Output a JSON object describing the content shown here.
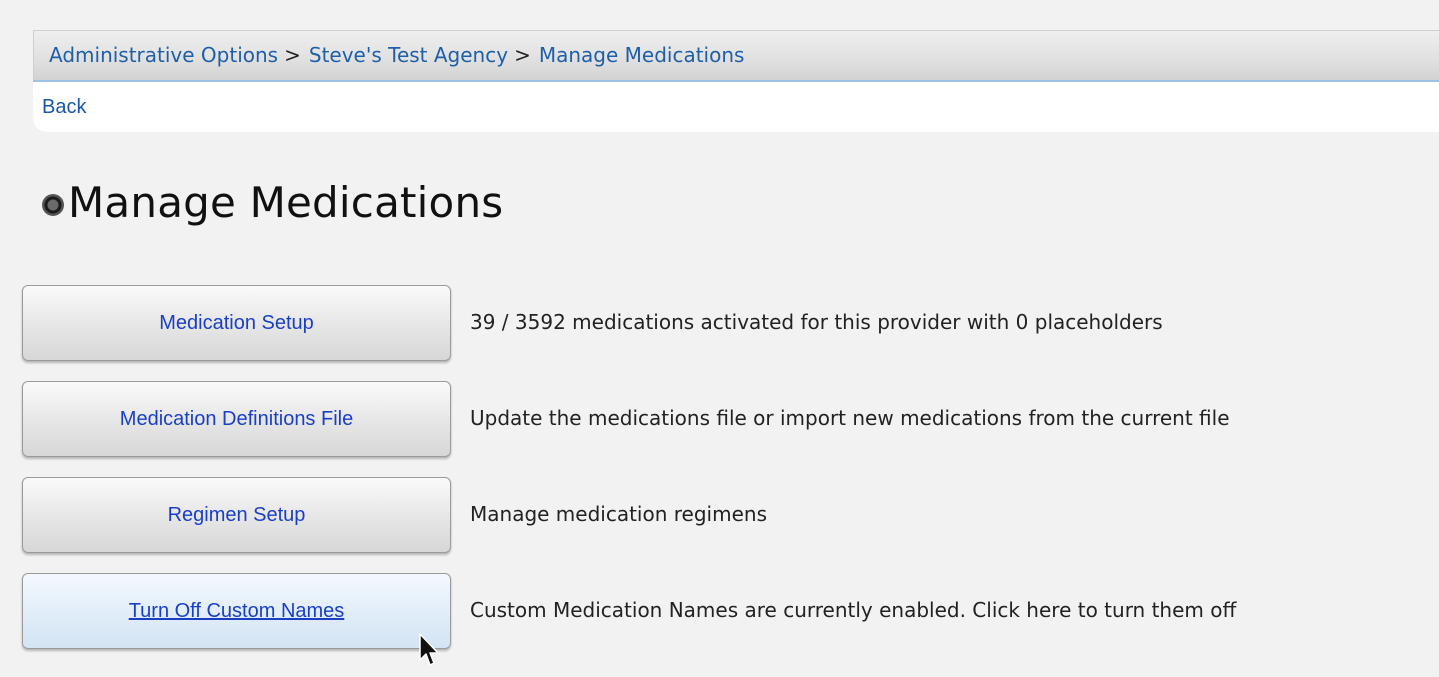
{
  "breadcrumb": {
    "items": [
      "Administrative Options",
      "Steve's Test Agency",
      "Manage Medications"
    ],
    "separator": ">"
  },
  "nav": {
    "back_label": "Back"
  },
  "page": {
    "title": "Manage Medications",
    "title_icon": "radio-bullet-icon"
  },
  "actions": [
    {
      "label": "Medication Setup",
      "description": "39 / 3592 medications activated for this provider with 0 placeholders"
    },
    {
      "label": "Medication Definitions File",
      "description": "Update the medications file or import new medications from the current file"
    },
    {
      "label": "Regimen Setup",
      "description": "Manage medication regimens"
    },
    {
      "label": "Turn Off Custom Names",
      "description": "Custom Medication Names are currently enabled. Click here to turn them off"
    }
  ],
  "colors": {
    "link": "#1a3fc4",
    "breadcrumb_link": "#1f5fa8",
    "background": "#f2f2f2"
  }
}
